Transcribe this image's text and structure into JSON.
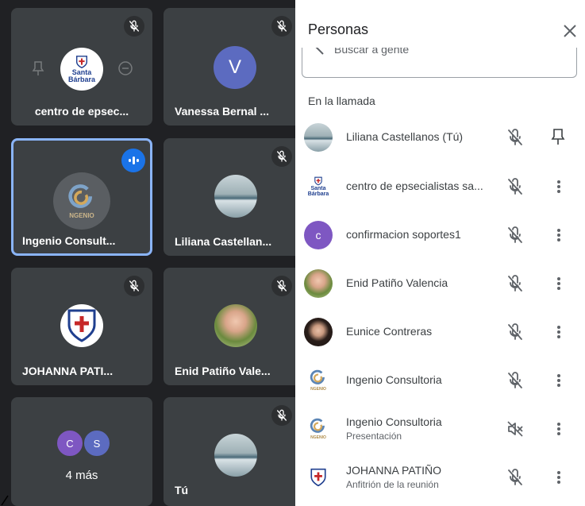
{
  "grid": {
    "tiles": [
      {
        "name": "centro de epsec...",
        "logo_text": "Santa Bárbara"
      },
      {
        "name": "Vanessa Bernal ...",
        "initial": "V"
      },
      {
        "name": "Ingenio Consult...",
        "logo_text": "NGENIO",
        "speaking": true
      },
      {
        "name": "Liliana Castellan..."
      },
      {
        "name": "JOHANNA PATI..."
      },
      {
        "name": "Enid Patiño Vale..."
      },
      {
        "name": "4 más",
        "mini_initials": [
          "C",
          "S"
        ]
      },
      {
        "name": "Tú"
      }
    ]
  },
  "panel": {
    "title": "Personas",
    "search_placeholder": "Buscar a gente",
    "section_label": "En la llamada",
    "participants": [
      {
        "name": "Liliana Castellanos (Tú)",
        "subtitle": "",
        "avatar": "photo",
        "action_icon": "pin-icon"
      },
      {
        "name": "centro de epsecialistas sa...",
        "subtitle": "",
        "avatar": "santa-barbara-logo",
        "logo_text": "Santa Bárbara",
        "action_icon": "more-vert-icon"
      },
      {
        "name": "confirmacion soportes1",
        "subtitle": "",
        "avatar": "initial",
        "initial": "c",
        "action_icon": "more-vert-icon"
      },
      {
        "name": "Enid Patiño Valencia",
        "subtitle": "",
        "avatar": "photo",
        "action_icon": "more-vert-icon"
      },
      {
        "name": "Eunice Contreras",
        "subtitle": "",
        "avatar": "photo",
        "action_icon": "more-vert-icon"
      },
      {
        "name": "Ingenio Consultoria",
        "subtitle": "",
        "avatar": "ingenio-logo",
        "logo_text": "NGENIO",
        "action_icon": "more-vert-icon"
      },
      {
        "name": "Ingenio Consultoria",
        "subtitle": "Presentación",
        "avatar": "ingenio-logo",
        "logo_text": "NGENIO",
        "action_icon": "more-vert-icon",
        "mic_icon": "presentation-off-icon"
      },
      {
        "name": "JOHANNA PATIÑO",
        "subtitle": "Anfitrión de la reunión",
        "avatar": "shield-logo",
        "action_icon": "more-vert-icon"
      }
    ]
  },
  "colors": {
    "grid_bg": "#202124",
    "tile_bg": "#3c4043",
    "speaking_border": "#8ab4f8",
    "speaking_badge": "#1a73e8",
    "vanessa_avatar": "#5c6bc0",
    "confirm_avatar": "#7e57c2",
    "more_c": "#7e57c2",
    "more_s": "#5c6bc0",
    "text_dark": "#3c4043",
    "icon_gray": "#5f6368"
  }
}
